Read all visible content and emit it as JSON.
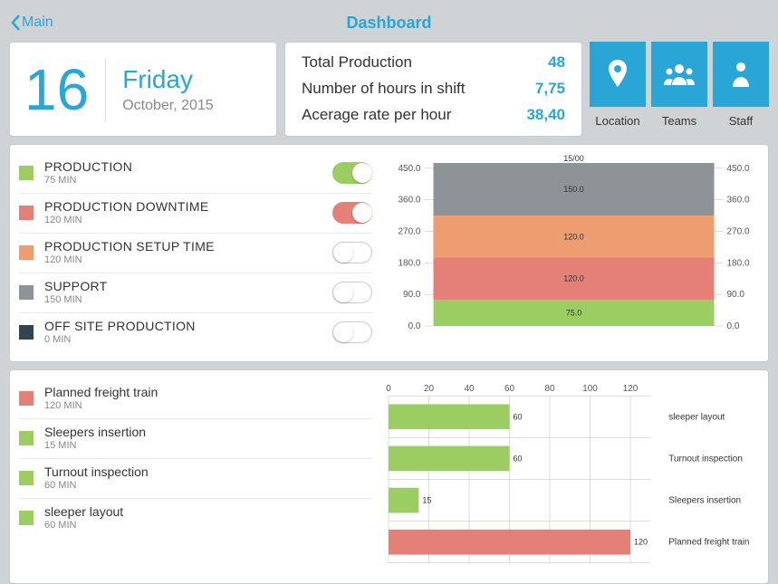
{
  "nav": {
    "back": "Main",
    "title": "Dashboard"
  },
  "date": {
    "num": "16",
    "day": "Friday",
    "sub": "October, 2015"
  },
  "stats": {
    "items": [
      {
        "label": "Total Production",
        "value": "48"
      },
      {
        "label": "Number of hours in shift",
        "value": "7,75"
      },
      {
        "label": "Acerage rate per hour",
        "value": "38,40"
      }
    ]
  },
  "navbtns": {
    "items": [
      {
        "label": "Location"
      },
      {
        "label": "Teams"
      },
      {
        "label": "Staff"
      }
    ]
  },
  "categories": [
    {
      "name": "PRODUCTION",
      "min": "75 MIN",
      "color": "#9ccd62",
      "toggle": "on-green"
    },
    {
      "name": "PRODUCTION DOWNTIME",
      "min": "120 MIN",
      "color": "#e58078",
      "toggle": "on-red"
    },
    {
      "name": "PRODUCTION SETUP TIME",
      "min": "120 MIN",
      "color": "#ed9d6f",
      "toggle": "off"
    },
    {
      "name": "SUPPORT",
      "min": "150 MIN",
      "color": "#8e9398",
      "toggle": "off"
    },
    {
      "name": "OFF SITE PRODUCTION",
      "min": "0 MIN",
      "color": "#32454c",
      "toggle": "off"
    }
  ],
  "tasks": [
    {
      "name": "Planned freight train",
      "min": "120 MIN",
      "color": "#e58078"
    },
    {
      "name": "Sleepers insertion",
      "min": "15 MIN",
      "color": "#9ccd62"
    },
    {
      "name": "Turnout inspection",
      "min": "60 MIN",
      "color": "#9ccd62"
    },
    {
      "name": "sleeper layout",
      "min": "60 MIN",
      "color": "#9ccd62"
    }
  ],
  "chart_data": [
    {
      "type": "bar",
      "stacked": true,
      "orientation": "vertical",
      "title": "15/00",
      "x": [
        "15/00"
      ],
      "series": [
        {
          "name": "PRODUCTION",
          "color": "#9ccd62",
          "values": [
            75.0
          ]
        },
        {
          "name": "PRODUCTION DOWNTIME",
          "color": "#e58078",
          "values": [
            120.0
          ]
        },
        {
          "name": "PRODUCTION SETUP TIME",
          "color": "#ed9d6f",
          "values": [
            120.0
          ]
        },
        {
          "name": "SUPPORT",
          "color": "#8e9398",
          "values": [
            150.0
          ]
        }
      ],
      "y_ticks_left": [
        0.0,
        90.0,
        180.0,
        270.0,
        360.0,
        450.0
      ],
      "y_ticks_right": [
        0.0,
        90.0,
        180.0,
        270.0,
        360.0,
        450.0
      ],
      "ylim": [
        0,
        465
      ]
    },
    {
      "type": "bar",
      "orientation": "horizontal",
      "x_ticks": [
        0,
        20,
        40,
        60,
        80,
        100,
        120
      ],
      "xlim": [
        0,
        130
      ],
      "series": [
        {
          "name": "sleeper layout",
          "color": "#9ccd62",
          "value": 60
        },
        {
          "name": "Turnout inspection",
          "color": "#9ccd62",
          "value": 60
        },
        {
          "name": "Sleepers insertion",
          "color": "#9ccd62",
          "value": 15
        },
        {
          "name": "Planned freight train",
          "color": "#e58078",
          "value": 120
        }
      ]
    }
  ]
}
